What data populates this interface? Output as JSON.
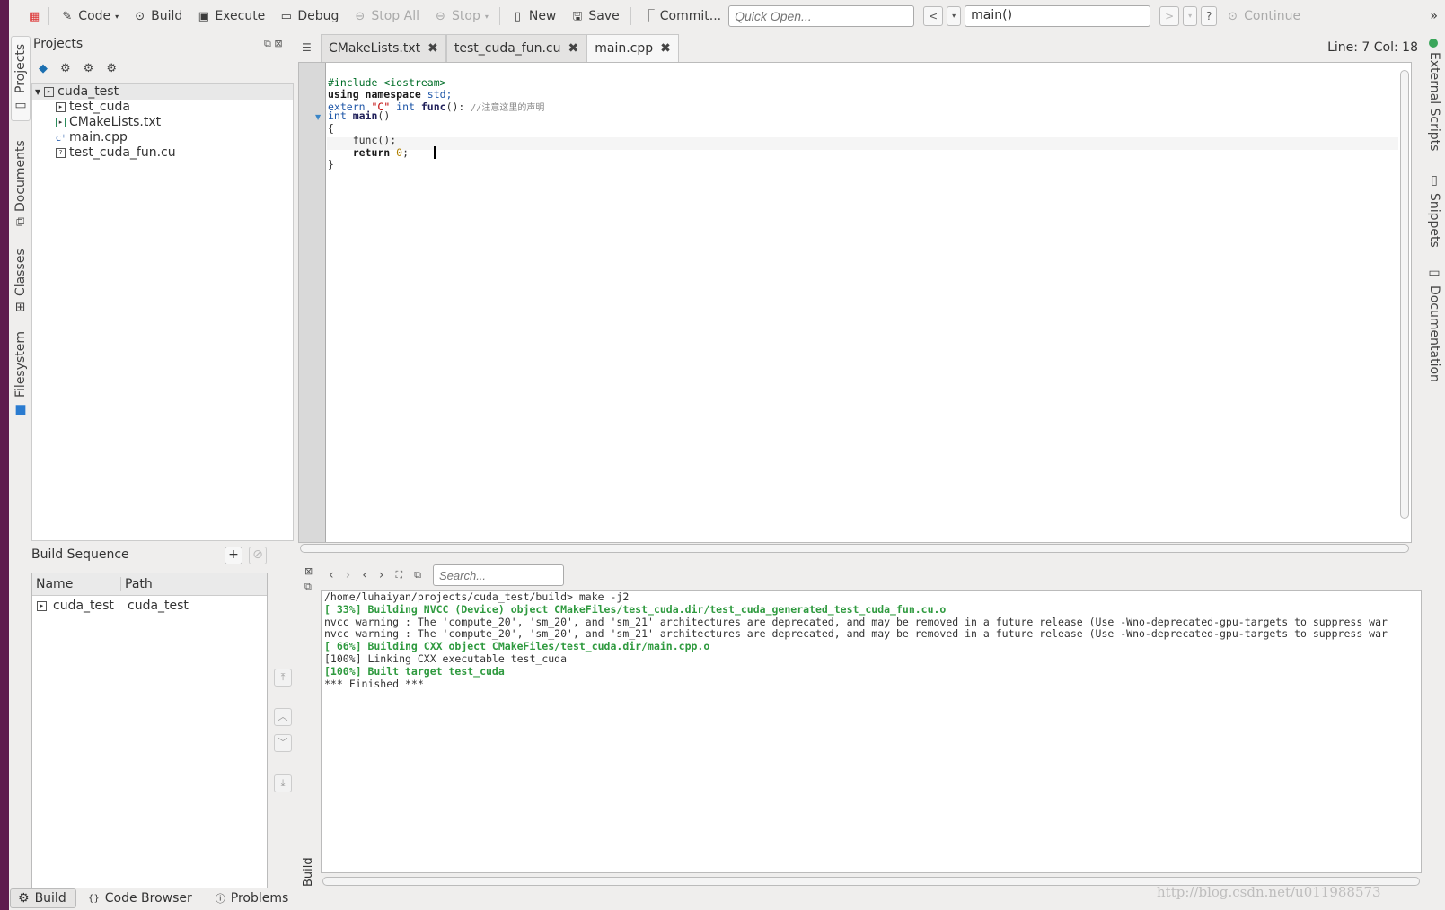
{
  "toolbar": {
    "code": "Code",
    "build": "Build",
    "execute": "Execute",
    "debug": "Debug",
    "stop_all": "Stop All",
    "stop": "Stop",
    "new": "New",
    "save": "Save",
    "commit": "Commit...",
    "quick_open_placeholder": "Quick Open...",
    "context": "main()",
    "continue": "Continue",
    "more": "»"
  },
  "left_tabs": [
    "Projects",
    "Documents",
    "Classes",
    "Filesystem"
  ],
  "right_tabs": [
    "External Scripts",
    "Snippets",
    "Documentation"
  ],
  "projects": {
    "title": "Projects",
    "tree": {
      "root": "cuda_test",
      "children": [
        "test_cuda",
        "CMakeLists.txt",
        "main.cpp",
        "test_cuda_fun.cu"
      ]
    }
  },
  "build_sequence": {
    "title": "Build Sequence",
    "columns": [
      "Name",
      "Path"
    ],
    "rows": [
      {
        "name": "cuda_test",
        "path": "cuda_test"
      }
    ]
  },
  "editor": {
    "tabs": [
      "CMakeLists.txt",
      "test_cuda_fun.cu",
      "main.cpp"
    ],
    "active_tab": "main.cpp",
    "cursor": "Line: 7 Col: 18",
    "code": {
      "l1": "#include <iostream>",
      "l2a": "using namespace",
      "l2b": " std;",
      "l3a": "extern ",
      "l3b": "\"C\"",
      "l3c": " int ",
      "l3d": "func",
      "l3e": "(): ",
      "l3f": "//注意这里的声明",
      "l4a": "int ",
      "l4b": "main",
      "l4c": "()",
      "l5": "{",
      "l6": "    func();",
      "l7a": "    return ",
      "l7b": "0",
      "l7c": ";",
      "l8": "}"
    }
  },
  "build_output": {
    "search_placeholder": "Search...",
    "panel_label": "Build",
    "lines": [
      "/home/luhaiyan/projects/cuda_test/build> make -j2",
      "[ 33%] Building NVCC (Device) object CMakeFiles/test_cuda.dir/test_cuda_generated_test_cuda_fun.cu.o",
      "nvcc warning : The 'compute_20', 'sm_20', and 'sm_21' architectures are deprecated, and may be removed in a future release (Use -Wno-deprecated-gpu-targets to suppress war",
      "nvcc warning : The 'compute_20', 'sm_20', and 'sm_21' architectures are deprecated, and may be removed in a future release (Use -Wno-deprecated-gpu-targets to suppress war",
      "[ 66%] Building CXX object CMakeFiles/test_cuda.dir/main.cpp.o",
      "[100%] Linking CXX executable test_cuda",
      "[100%] Built target test_cuda",
      "*** Finished ***"
    ]
  },
  "bottom_tabs": [
    "Build",
    "Code Browser",
    "Problems"
  ],
  "watermark": "http://blog.csdn.net/u011988573"
}
